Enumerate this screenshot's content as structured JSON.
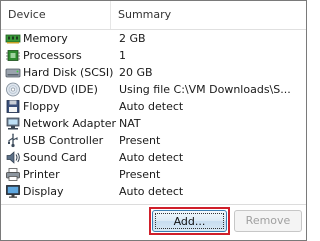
{
  "columns": {
    "device": "Device",
    "summary": "Summary"
  },
  "devices": [
    {
      "name": "Memory",
      "summary": "2 GB",
      "icon": "memory-icon"
    },
    {
      "name": "Processors",
      "summary": "1",
      "icon": "processor-icon"
    },
    {
      "name": "Hard Disk (SCSI)",
      "summary": "20 GB",
      "icon": "hard-disk-icon"
    },
    {
      "name": "CD/DVD (IDE)",
      "summary": "Using file C:\\VM Downloads\\S...",
      "icon": "cd-dvd-icon"
    },
    {
      "name": "Floppy",
      "summary": "Auto detect",
      "icon": "floppy-icon"
    },
    {
      "name": "Network Adapter",
      "summary": "NAT",
      "icon": "network-adapter-icon"
    },
    {
      "name": "USB Controller",
      "summary": "Present",
      "icon": "usb-icon"
    },
    {
      "name": "Sound Card",
      "summary": "Auto detect",
      "icon": "sound-card-icon"
    },
    {
      "name": "Printer",
      "summary": "Present",
      "icon": "printer-icon"
    },
    {
      "name": "Display",
      "summary": "Auto detect",
      "icon": "display-icon"
    }
  ],
  "buttons": {
    "add": "Add...",
    "remove": "Remove"
  },
  "colors": {
    "highlight": "#d01f2a",
    "button_border": "#3c7fb1"
  }
}
